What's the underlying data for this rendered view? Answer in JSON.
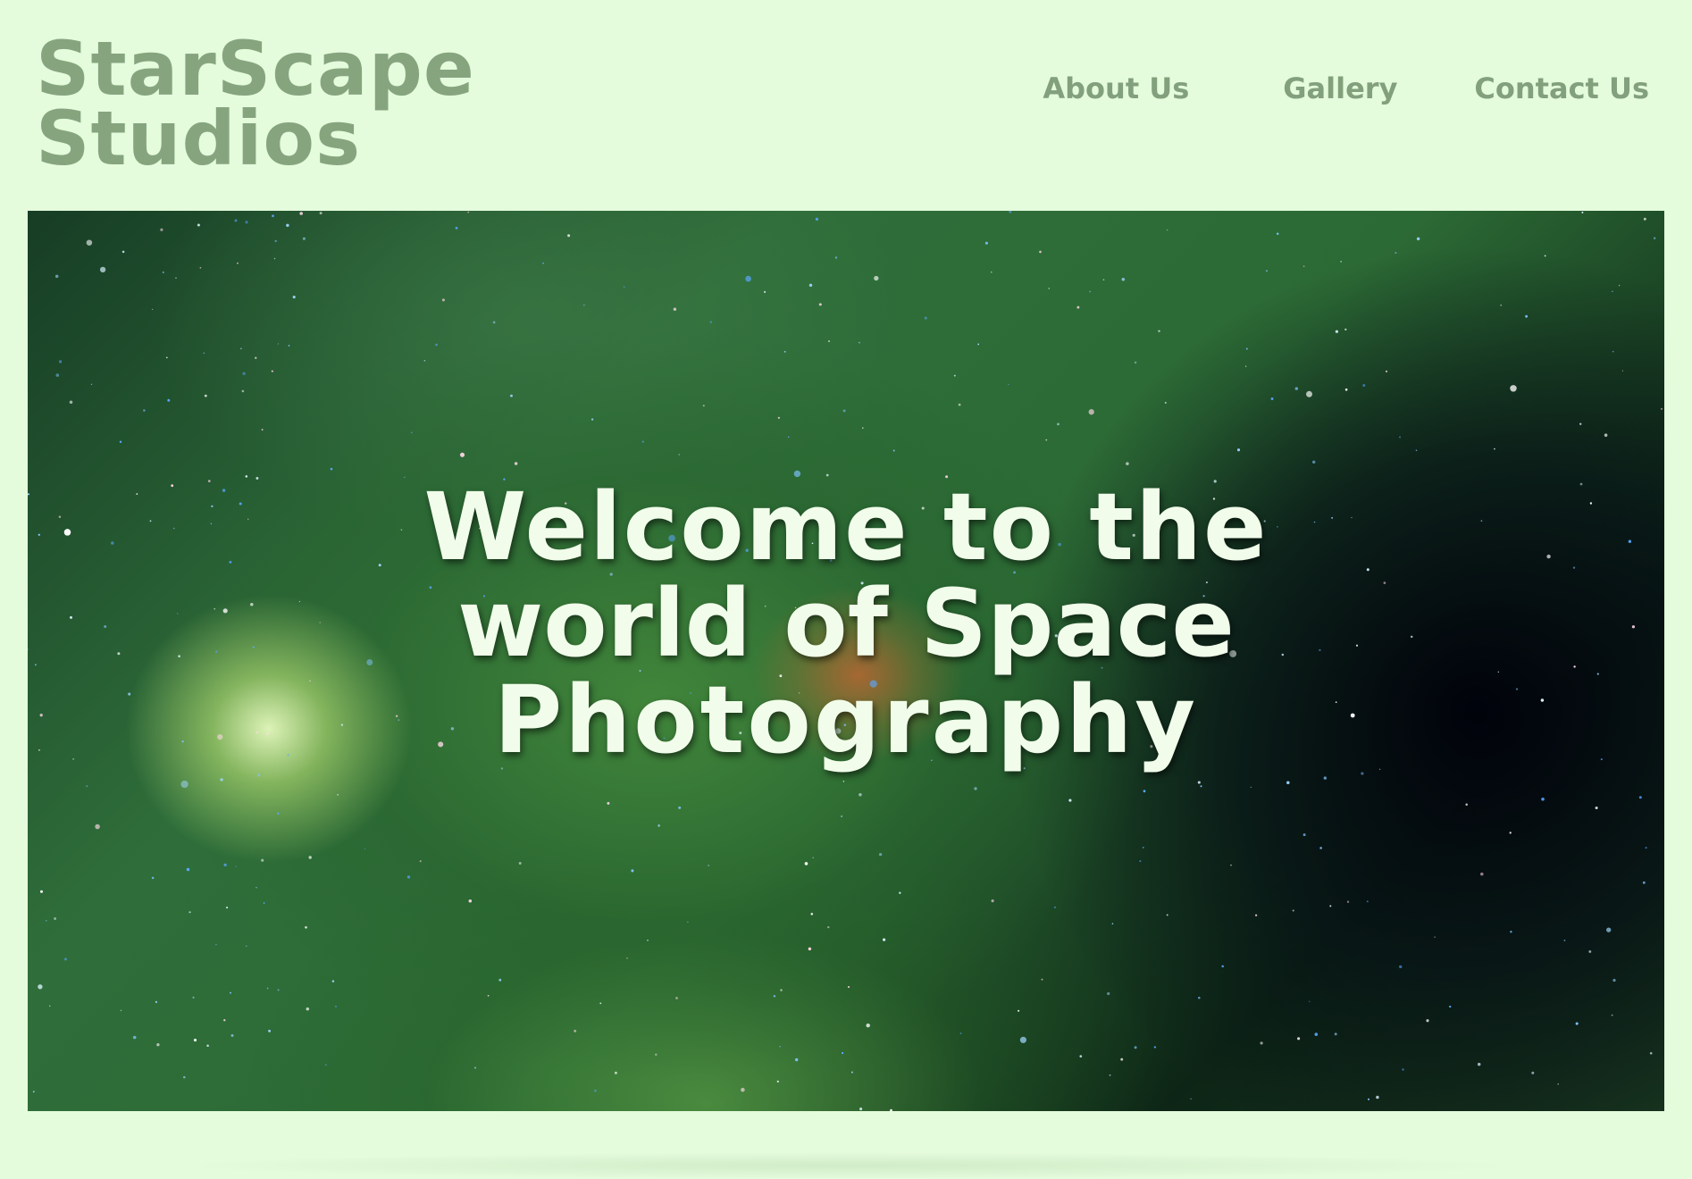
{
  "brand": {
    "line1": "StarScape",
    "line2": "Studios"
  },
  "nav": {
    "items": [
      {
        "label": "About Us"
      },
      {
        "label": "Gallery"
      },
      {
        "label": "Contact Us"
      }
    ]
  },
  "hero": {
    "title_line1": "Welcome to the",
    "title_line2": "world of Space",
    "title_line3": "Photography"
  },
  "colors": {
    "page_background": "#e4fbdc",
    "brand_text": "#86a57f",
    "nav_text": "#82a07c",
    "hero_text": "#f1fdea"
  }
}
